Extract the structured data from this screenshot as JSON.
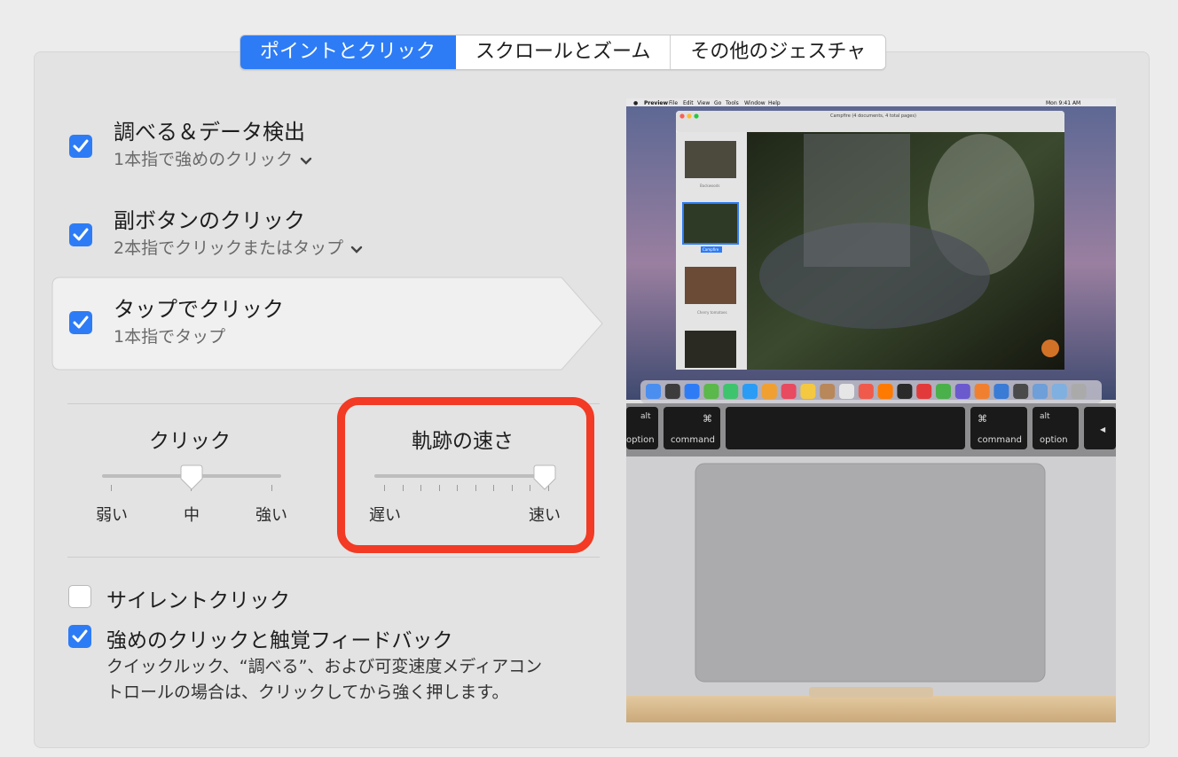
{
  "tabs": [
    {
      "label": "ポイントとクリック",
      "active": true
    },
    {
      "label": "スクロールとズーム",
      "active": false
    },
    {
      "label": "その他のジェスチャ",
      "active": false
    }
  ],
  "options": {
    "lookup": {
      "title": "調べる＆データ検出",
      "subtitle": "1本指で強めのクリック",
      "checked": true
    },
    "secondary": {
      "title": "副ボタンのクリック",
      "subtitle": "2本指でクリックまたはタップ",
      "checked": true
    },
    "tap": {
      "title": "タップでクリック",
      "subtitle": "1本指でタップ",
      "checked": true
    }
  },
  "click_slider": {
    "title": "クリック",
    "labels": [
      "弱い",
      "中",
      "強い"
    ],
    "value": 0.5
  },
  "tracking_slider": {
    "title": "軌跡の速さ",
    "labels": [
      "遅い",
      "速い"
    ],
    "value": 1.0
  },
  "bottom": {
    "silent": {
      "title": "サイレントクリック",
      "checked": false
    },
    "force": {
      "title": "強めのクリックと触覚フィードバック",
      "checked": true,
      "desc_line1": "クイックルック、“調べる”、および可変速度メディアコン",
      "desc_line2": "トロールの場合は、クリックしてから強く押します。"
    }
  },
  "illustration": {
    "menubar": {
      "app": "Preview",
      "items": [
        "File",
        "Edit",
        "View",
        "Go",
        "Tools",
        "Window",
        "Help"
      ],
      "clock": "Mon 9:41 AM"
    },
    "window_title": "Campfire (4 documents, 4 total pages)",
    "thumbs": [
      "Backwoods",
      "Campfire",
      "Cherry tomatoes"
    ],
    "keys": {
      "alt": "alt",
      "option": "option",
      "cmd_symbol": "⌘",
      "command": "command",
      "arrow": "◀"
    }
  },
  "colors": {
    "accent": "#2d7cf6",
    "highlight": "#f23a24"
  }
}
